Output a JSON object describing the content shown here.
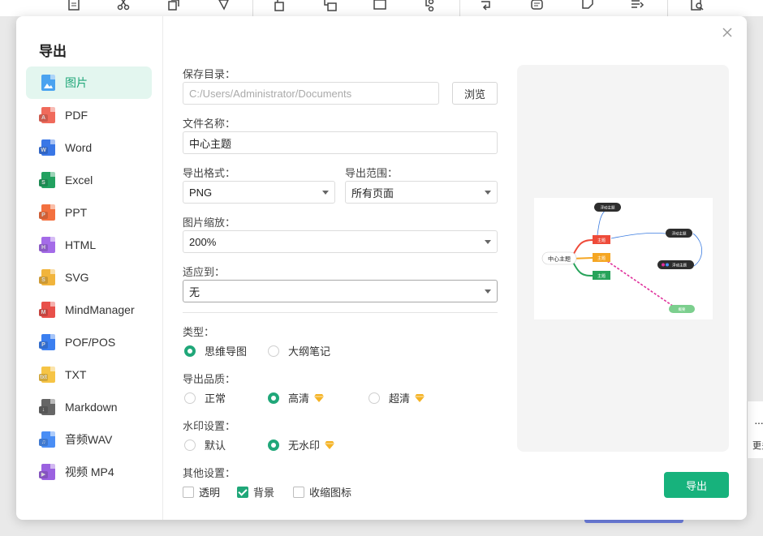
{
  "dialog": {
    "title": "导出"
  },
  "nav": [
    {
      "label": "图片",
      "icon": "image-file-icon",
      "color": "#4aa3f0",
      "tag": ""
    },
    {
      "label": "PDF",
      "icon": "pdf-file-icon",
      "color": "#f06a5b",
      "tag": "A"
    },
    {
      "label": "Word",
      "icon": "word-file-icon",
      "color": "#3a77e6",
      "tag": "W"
    },
    {
      "label": "Excel",
      "icon": "excel-file-icon",
      "color": "#22a160",
      "tag": "S"
    },
    {
      "label": "PPT",
      "icon": "ppt-file-icon",
      "color": "#f3703f",
      "tag": "P"
    },
    {
      "label": "HTML",
      "icon": "html-file-icon",
      "color": "#a46be8",
      "tag": "H"
    },
    {
      "label": "SVG",
      "icon": "svg-file-icon",
      "color": "#f1b43c",
      "tag": "S"
    },
    {
      "label": "MindManager",
      "icon": "mindmanager-file-icon",
      "color": "#e8504a",
      "tag": "M"
    },
    {
      "label": "POF/POS",
      "icon": "pof-file-icon",
      "color": "#3b7ff0",
      "tag": "P"
    },
    {
      "label": "TXT",
      "icon": "txt-file-icon",
      "color": "#f6c445",
      "tag": "txt"
    },
    {
      "label": "Markdown",
      "icon": "markdown-file-icon",
      "color": "#666666",
      "tag": "↓"
    },
    {
      "label": "音频WAV",
      "icon": "audio-file-icon",
      "color": "#4a8ef5",
      "tag": "♫"
    },
    {
      "label": "视频 MP4",
      "icon": "video-file-icon",
      "color": "#9b62e0",
      "tag": "▶"
    }
  ],
  "form": {
    "save_dir_label": "保存目录：",
    "save_dir_value": "C:/Users/Administrator/Documents",
    "browse_label": "浏览",
    "filename_label": "文件名称：",
    "filename_value": "中心主题",
    "format_label": "导出格式：",
    "format_value": "PNG",
    "range_label": "导出范围：",
    "range_value": "所有页面",
    "scale_label": "图片缩放：",
    "scale_value": "200%",
    "fit_label": "适应到：",
    "fit_value": "无",
    "type_label": "类型：",
    "type_options": [
      "思维导图",
      "大纲笔记"
    ],
    "type_selected": "思维导图",
    "quality_label": "导出品质：",
    "quality_options": [
      "正常",
      "高清",
      "超清"
    ],
    "quality_selected": "高清",
    "watermark_label": "水印设置：",
    "watermark_options": [
      "默认",
      "无水印"
    ],
    "watermark_selected": "无水印",
    "other_label": "其他设置：",
    "other_options": [
      {
        "label": "透明",
        "checked": false
      },
      {
        "label": "背景",
        "checked": true
      },
      {
        "label": "收缩图标",
        "checked": false
      }
    ],
    "export_label": "导出"
  },
  "preview": {
    "center": "中心主题",
    "topics": [
      "主题",
      "主题",
      "主题"
    ],
    "floating": [
      "浮动主题",
      "浮动主题",
      "浮动主题"
    ],
    "summary": "概要",
    "colors": {
      "red": "#ee4b3a",
      "orange": "#f5a623",
      "green": "#27a35a",
      "dark": "#2d2d2d",
      "pink": "#e0309b"
    }
  },
  "background": {
    "right_more_label": "更多",
    "accent": "#17b27c"
  }
}
